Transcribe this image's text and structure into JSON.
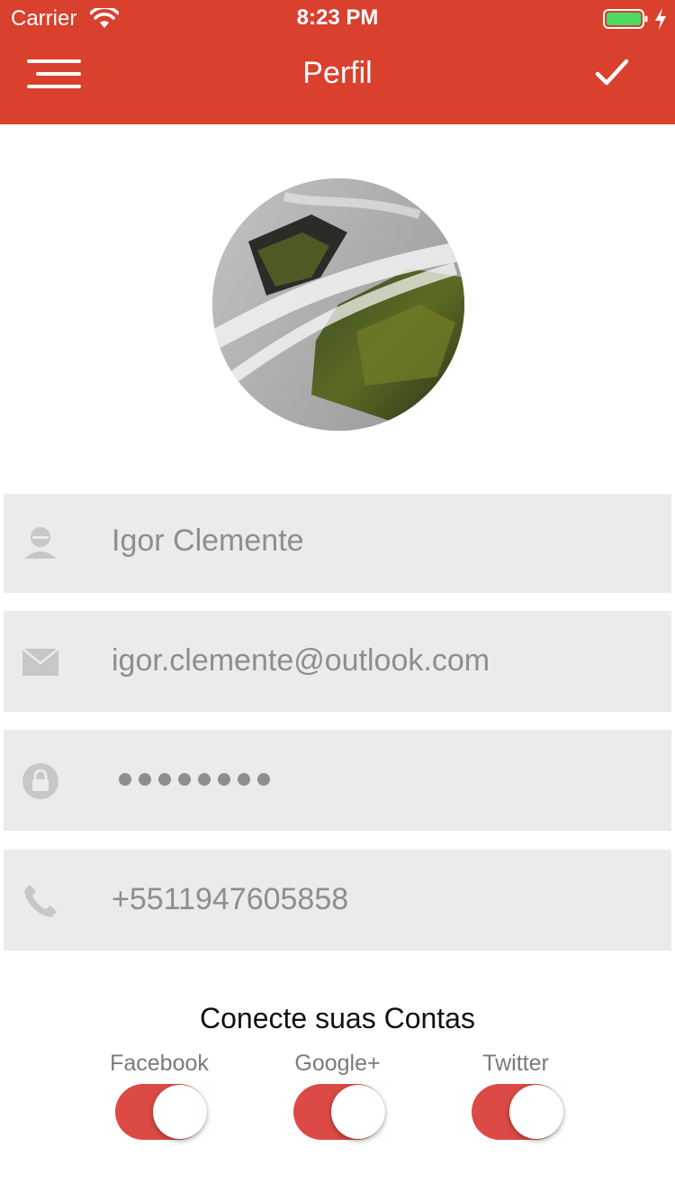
{
  "status_bar": {
    "carrier": "Carrier",
    "time": "8:23 PM"
  },
  "nav": {
    "title": "Perfil",
    "menu_icon": "hamburger-menu-icon",
    "confirm_icon": "checkmark-icon"
  },
  "colors": {
    "primary": "#d9402d",
    "toggle_on": "#db4a45",
    "field_bg": "#ebebeb",
    "field_text": "#8e8e8e"
  },
  "profile": {
    "avatar_alt": "waterfall-photo",
    "name": "Igor Clemente",
    "email": "igor.clemente@outlook.com",
    "password_masked": "••••••••",
    "phone": "+5511947605858"
  },
  "connect": {
    "title": "Conecte suas Contas",
    "accounts": [
      {
        "label": "Facebook",
        "enabled": true
      },
      {
        "label": "Google+",
        "enabled": true
      },
      {
        "label": "Twitter",
        "enabled": true
      }
    ]
  }
}
